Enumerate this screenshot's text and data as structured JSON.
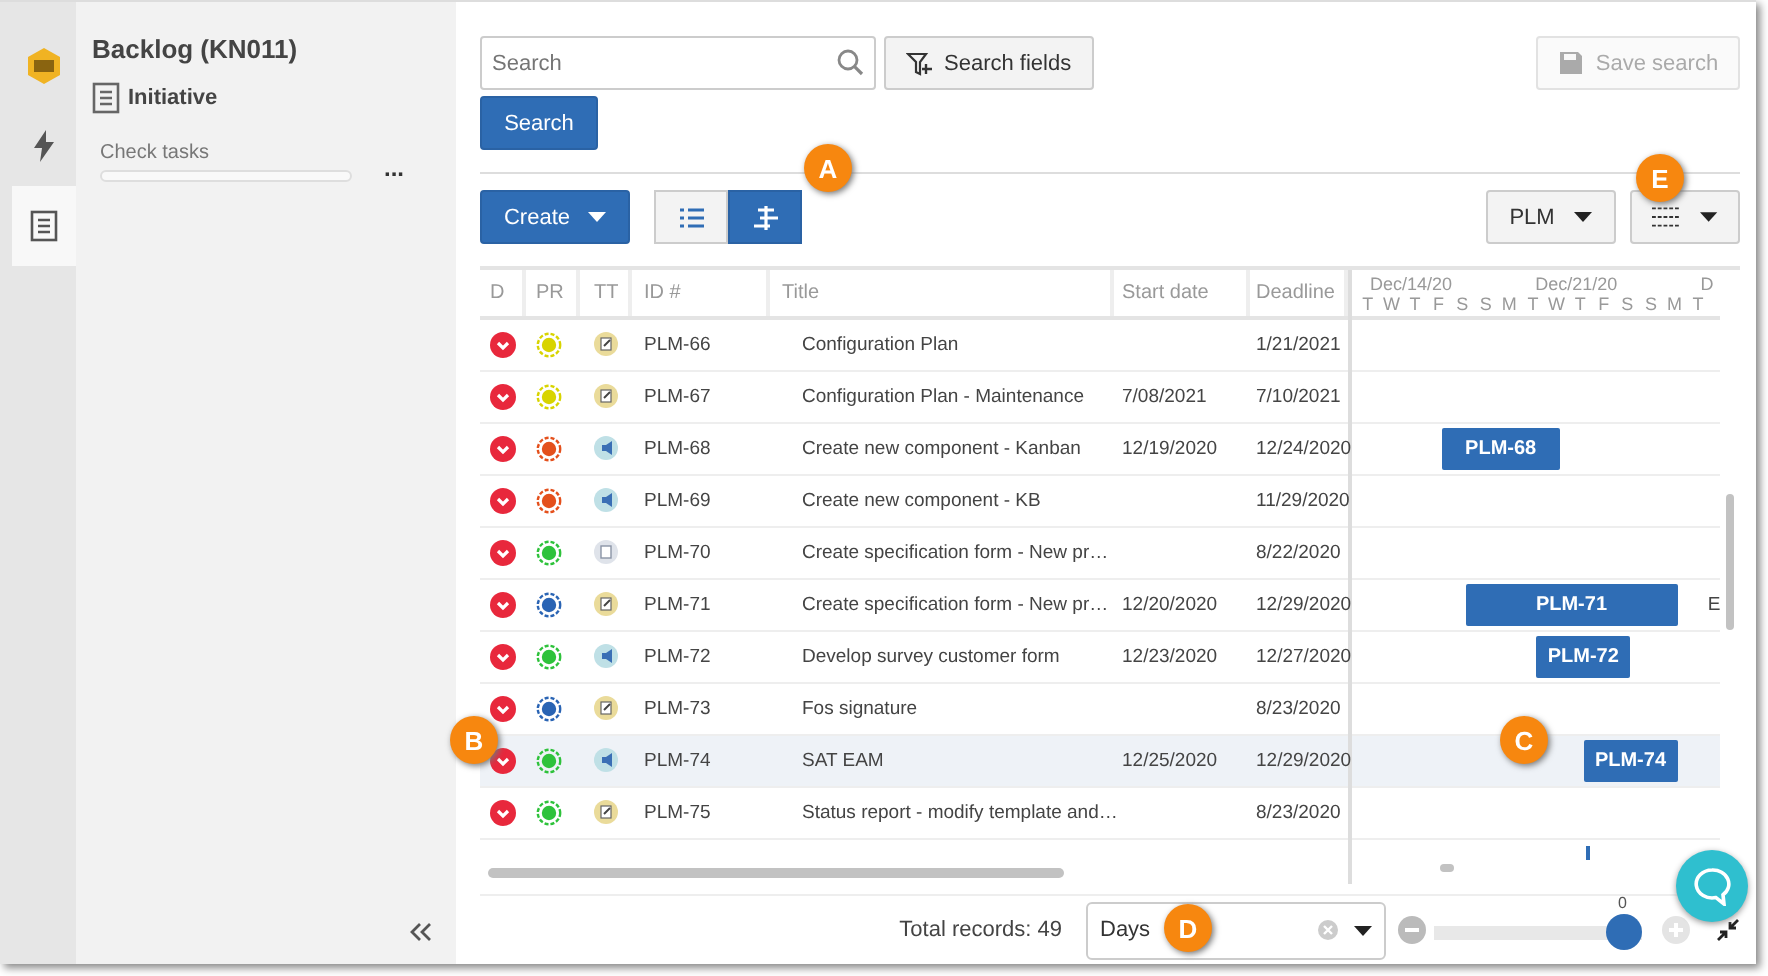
{
  "rail": [
    {
      "kind": "logo",
      "selected": false
    },
    {
      "kind": "bolt",
      "selected": false
    },
    {
      "kind": "document",
      "selected": true
    }
  ],
  "sidebar": {
    "title": "Backlog (KN011)",
    "subtitle": "Initiative",
    "task_label": "Check tasks",
    "task_progress": {
      "level": 0
    },
    "more": "..."
  },
  "search": {
    "placeholder": "Search",
    "fields_button": "Search fields",
    "search_button": "Search",
    "save_button": "Save search",
    "save_disabled": true
  },
  "toolbar": {
    "create": "Create",
    "views": [
      {
        "kind": "list",
        "selected": false
      },
      {
        "kind": "gantt",
        "selected": true
      }
    ],
    "project": "PLM"
  },
  "table": {
    "columns": [
      "D",
      "PR",
      "TT",
      "ID #",
      "Title",
      "Start date",
      "Deadline"
    ],
    "rows": [
      {
        "id": "PLM-66",
        "title": "Configuration Plan",
        "deadline": "1/21/2021",
        "color": "#d8d400",
        "kind": "note",
        "selected": false
      },
      {
        "id": "PLM-67",
        "title": "Configuration Plan - Maintenance",
        "start_date": "7/08/2021",
        "deadline": "7/10/2021",
        "color": "#d8d400",
        "kind": "note",
        "selected": false
      },
      {
        "id": "PLM-68",
        "title": "Create new component - Kanban",
        "start_date": "12/19/2020",
        "deadline": "12/24/2020",
        "color": "#e4501c",
        "kind": "megaphone",
        "selected": false,
        "bar_label": "PLM-68"
      },
      {
        "id": "PLM-69",
        "title": "Create new component - KB",
        "deadline": "11/29/2020",
        "color": "#e4501c",
        "kind": "megaphone",
        "selected": false
      },
      {
        "id": "PLM-70",
        "title": "Create specification form - New pr…",
        "deadline": "8/22/2020",
        "color": "#2ec23b",
        "kind": "page",
        "selected": false
      },
      {
        "id": "PLM-71",
        "title": "Create specification form - New pr…",
        "start_date": "12/20/2020",
        "deadline": "12/29/2020",
        "color": "#2a64b4",
        "kind": "note",
        "selected": false,
        "bar_label": "PLM-71",
        "gantt_note": "E"
      },
      {
        "id": "PLM-72",
        "title": "Develop survey customer form",
        "start_date": "12/23/2020",
        "deadline": "12/27/2020",
        "color": "#2ec23b",
        "kind": "megaphone",
        "selected": false,
        "bar_label": "PLM-72"
      },
      {
        "id": "PLM-73",
        "title": "Fos signature",
        "deadline": "8/23/2020",
        "color": "#2a64b4",
        "kind": "note",
        "selected": false
      },
      {
        "id": "PLM-74",
        "title": "SAT EAM",
        "start_date": "12/25/2020",
        "deadline": "12/29/2020",
        "color": "#2ec23b",
        "kind": "megaphone",
        "selected": true,
        "bar_label": "PLM-74"
      },
      {
        "id": "PLM-75",
        "title": "Status report - modify template and…",
        "deadline": "8/23/2020",
        "color": "#2ec23b",
        "kind": "note",
        "selected": false
      }
    ]
  },
  "gantt": {
    "weeks": [
      "Dec/14/20",
      "Dec/21/20",
      "D"
    ],
    "days": [
      "T",
      "W",
      "T",
      "F",
      "S",
      "S",
      "M",
      "T",
      "W",
      "T",
      "F",
      "S",
      "S",
      "M",
      "T"
    ]
  },
  "footer": {
    "total": "Total records: 49",
    "scale": "Days",
    "zoom": {
      "reading": "0",
      "level": 1
    }
  },
  "callouts": [
    "A",
    "B",
    "C",
    "D",
    "E"
  ]
}
